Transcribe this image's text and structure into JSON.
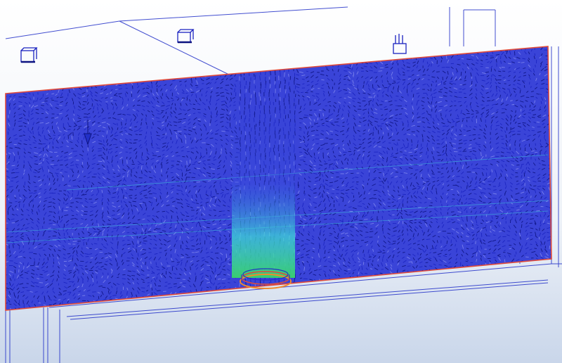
{
  "scene": {
    "description_free": true,
    "colors": {
      "background_top": "#ffffff",
      "background_bottom": "#c9d6ea",
      "wireframe": "#2230c8",
      "slab_fill": "#3a44d8",
      "vector_dark": "#0c1280",
      "vector_mid": "#1a22c0",
      "plume_green": "#39d46a",
      "plume_cyan": "#3ee0d8",
      "boundary_red": "#e04a3a",
      "source_orange": "#f08a2a"
    },
    "icons": [
      "sensor-cube-icon",
      "sensor-cube-icon",
      "sensor-probe-icon",
      "sprinkler-icon"
    ]
  }
}
